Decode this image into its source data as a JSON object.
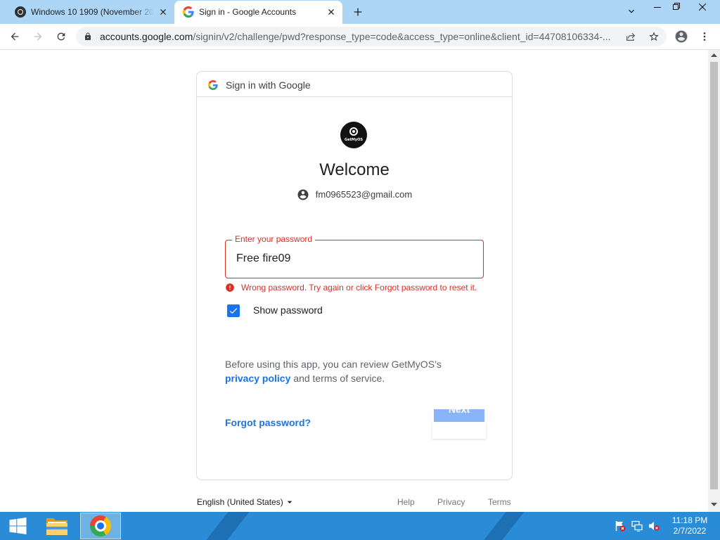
{
  "browser": {
    "tabs": [
      {
        "title": "Windows 10 1909 (November 20",
        "favicon": "getmyos-disc-icon",
        "active": false
      },
      {
        "title": "Sign in - Google Accounts",
        "favicon": "google-g-icon",
        "active": true
      }
    ],
    "omnibox": {
      "host": "accounts.google.com",
      "path": "/signin/v2/challenge/pwd?response_type=code&access_type=online&client_id=44708106334-..."
    },
    "toolbar_icons": [
      "back-arrow-icon",
      "forward-arrow-icon",
      "reload-icon",
      "lock-icon",
      "share-icon",
      "star-icon",
      "profile-icon",
      "kebab-menu-icon"
    ],
    "window_controls": [
      "chevron-down-icon",
      "minimize-icon",
      "restore-icon",
      "close-icon"
    ]
  },
  "signin": {
    "header": "Sign in with Google",
    "app_logo_text": "GetMyOS",
    "heading": "Welcome",
    "email": "fm0965523@gmail.com",
    "password": {
      "label": "Enter your password",
      "value": "Free fire09"
    },
    "error": "Wrong password. Try again or click Forgot password to reset it.",
    "show_password": {
      "label": "Show password",
      "checked": true
    },
    "consent": {
      "before": "Before using this app, you can review GetMyOS’s",
      "privacy_link": "privacy policy",
      "after": "and terms of service."
    },
    "forgot_password": "Forgot password?",
    "next_button": "Next"
  },
  "footer": {
    "language": "English (United States)",
    "links": [
      "Help",
      "Privacy",
      "Terms"
    ]
  },
  "taskbar": {
    "time": "11:18 PM",
    "date": "2/7/2022",
    "pinned": [
      "windows-start-icon",
      "file-explorer-icon",
      "chrome-icon"
    ],
    "tray_icons": [
      "action-center-flag-icon",
      "network-icon",
      "volume-muted-icon"
    ]
  },
  "colors": {
    "tabstrip": "#add6f6",
    "accent": "#1a73e8",
    "error": "#d93025",
    "taskbar": "#2a8cd6"
  }
}
